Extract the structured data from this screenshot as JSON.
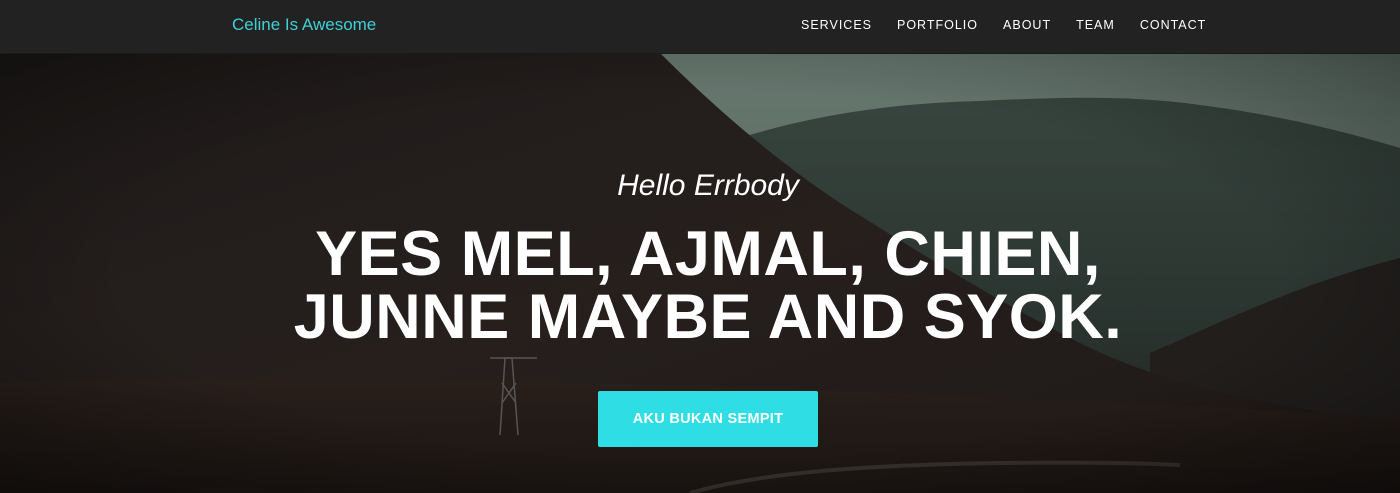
{
  "navbar": {
    "brand": "Celine Is Awesome",
    "links": [
      "SERVICES",
      "PORTFOLIO",
      "ABOUT",
      "TEAM",
      "CONTACT"
    ]
  },
  "hero": {
    "lead": "Hello Errbody",
    "headline_line1": "YES MEL, AJMAL, CHIEN,",
    "headline_line2": "JUNNE MAYBE AND SYOK.",
    "cta_label": "AKU BUKAN SEMPIT"
  },
  "colors": {
    "navbar_bg": "#222222",
    "brand": "#3fd0d4",
    "cta_bg": "#2fdde4",
    "text": "#ffffff"
  }
}
